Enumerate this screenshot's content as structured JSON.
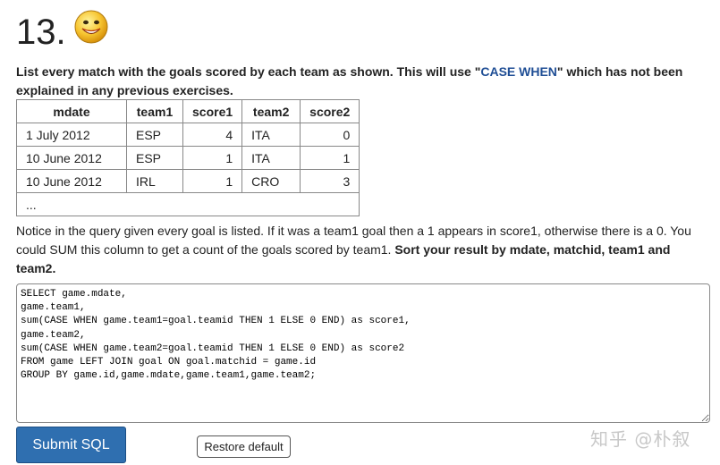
{
  "heading": {
    "number": "13."
  },
  "icons": {
    "emoticon": "smiley-face-icon"
  },
  "question": {
    "text_before": "List every match with the goals scored by each team as shown. This will use \"",
    "keyword": "CASE WHEN",
    "text_after": "\" which has not been explained in any previous exercises."
  },
  "sample_table": {
    "headers": [
      "mdate",
      "team1",
      "score1",
      "team2",
      "score2"
    ],
    "rows": [
      [
        "1 July 2012",
        "ESP",
        "4",
        "ITA",
        "0"
      ],
      [
        "10 June 2012",
        "ESP",
        "1",
        "ITA",
        "1"
      ],
      [
        "10 June 2012",
        "IRL",
        "1",
        "CRO",
        "3"
      ]
    ],
    "ellipsis": "..."
  },
  "notice": {
    "text": "Notice in the query given every goal is listed. If it was a team1 goal then a 1 appears in score1, otherwise there is a 0. You could SUM this column to get a count of the goals scored by team1. ",
    "bold": "Sort your result by mdate, matchid, team1 and team2."
  },
  "sql": {
    "value": "SELECT game.mdate,\ngame.team1,\nsum(CASE WHEN game.team1=goal.teamid THEN 1 ELSE 0 END) as score1,\ngame.team2,\nsum(CASE WHEN game.team2=goal.teamid THEN 1 ELSE 0 END) as score2\nFROM game LEFT JOIN goal ON goal.matchid = game.id\nGROUP BY game.id,game.mdate,game.team1,game.team2;"
  },
  "buttons": {
    "submit": "Submit SQL",
    "restore": "Restore default"
  },
  "watermark": "知乎 @朴叙"
}
